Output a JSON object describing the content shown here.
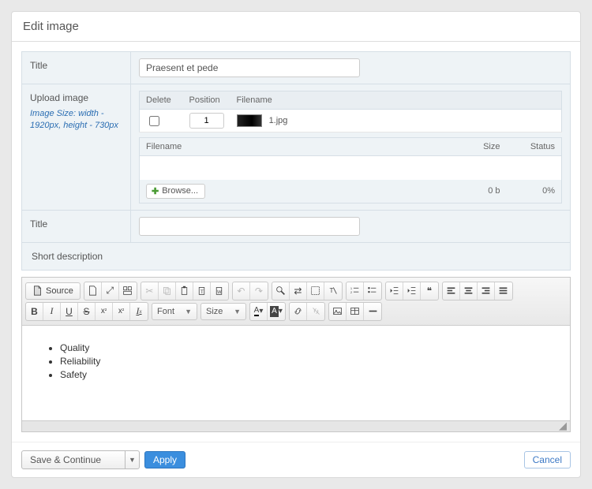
{
  "panel_title": "Edit image",
  "rows": {
    "title1_label": "Title",
    "title1_value": "Praesent et pede",
    "upload_label": "Upload image",
    "upload_hint": "Image Size: width - 1920px, height - 730px",
    "title2_label": "Title",
    "title2_value": "",
    "shortdesc_label": "Short description"
  },
  "image_table": {
    "col_delete": "Delete",
    "col_position": "Position",
    "col_filename": "Filename",
    "rows": [
      {
        "position": "1",
        "filename": "1.jpg",
        "delete_checked": false
      }
    ]
  },
  "uploader": {
    "col_filename": "Filename",
    "col_size": "Size",
    "col_status": "Status",
    "browse_label": "Browse...",
    "total_size": "0 b",
    "total_status": "0%"
  },
  "editor": {
    "source_label": "Source",
    "font_label": "Font",
    "size_label": "Size",
    "bullets": [
      "Quality",
      "Reliability",
      "Safety"
    ]
  },
  "footer": {
    "save_continue": "Save & Continue",
    "apply": "Apply",
    "cancel": "Cancel"
  }
}
